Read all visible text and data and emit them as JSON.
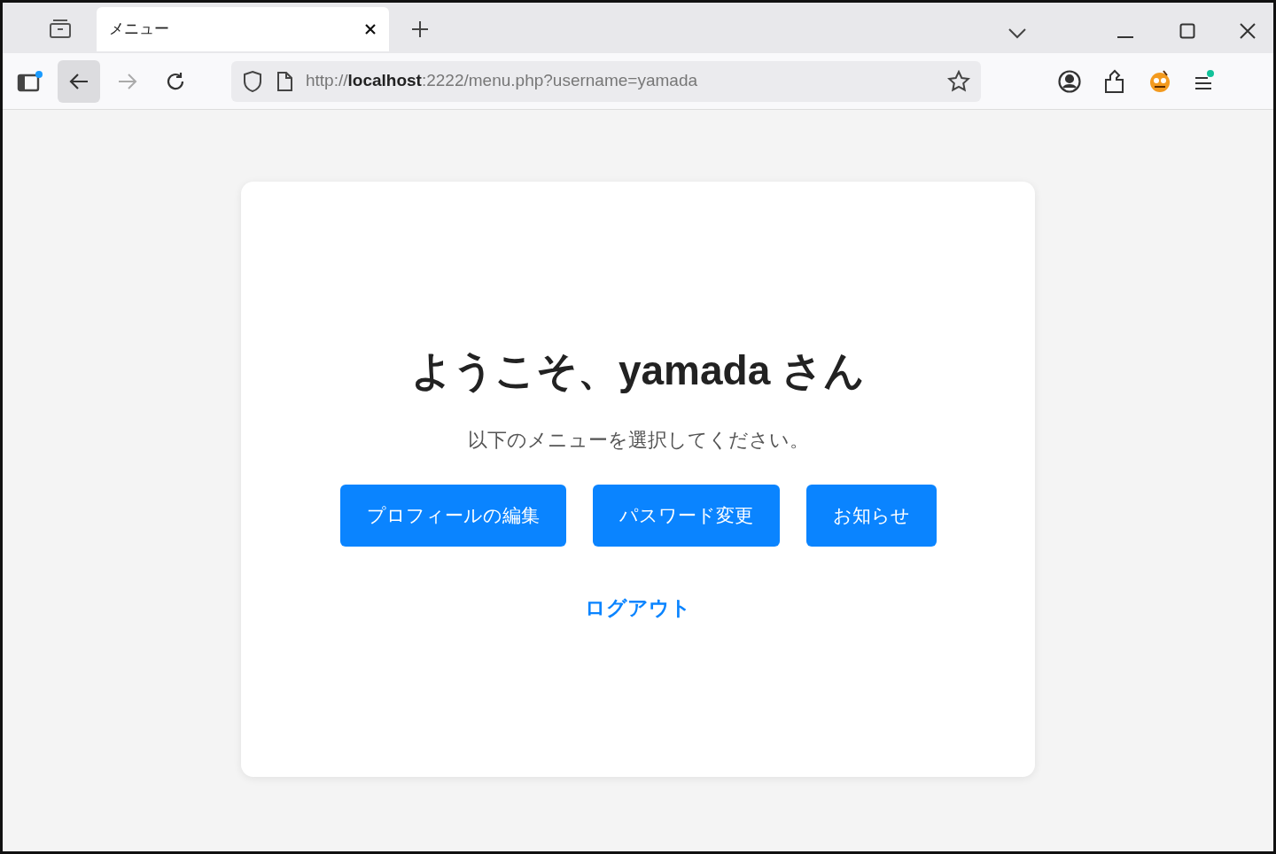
{
  "browser": {
    "tabs": [
      {
        "title": "メニュー",
        "selected": true
      }
    ],
    "address": "http://**localhost**:2222/menu.php?username=yamada"
  },
  "page": {
    "heading": "ようこそ、yamada さん",
    "subtitle": "以下のメニューを選択してください。",
    "buttons": [
      "プロフィールの編集",
      "パスワード変更",
      "お知らせ"
    ],
    "logout": "ログアウト"
  }
}
